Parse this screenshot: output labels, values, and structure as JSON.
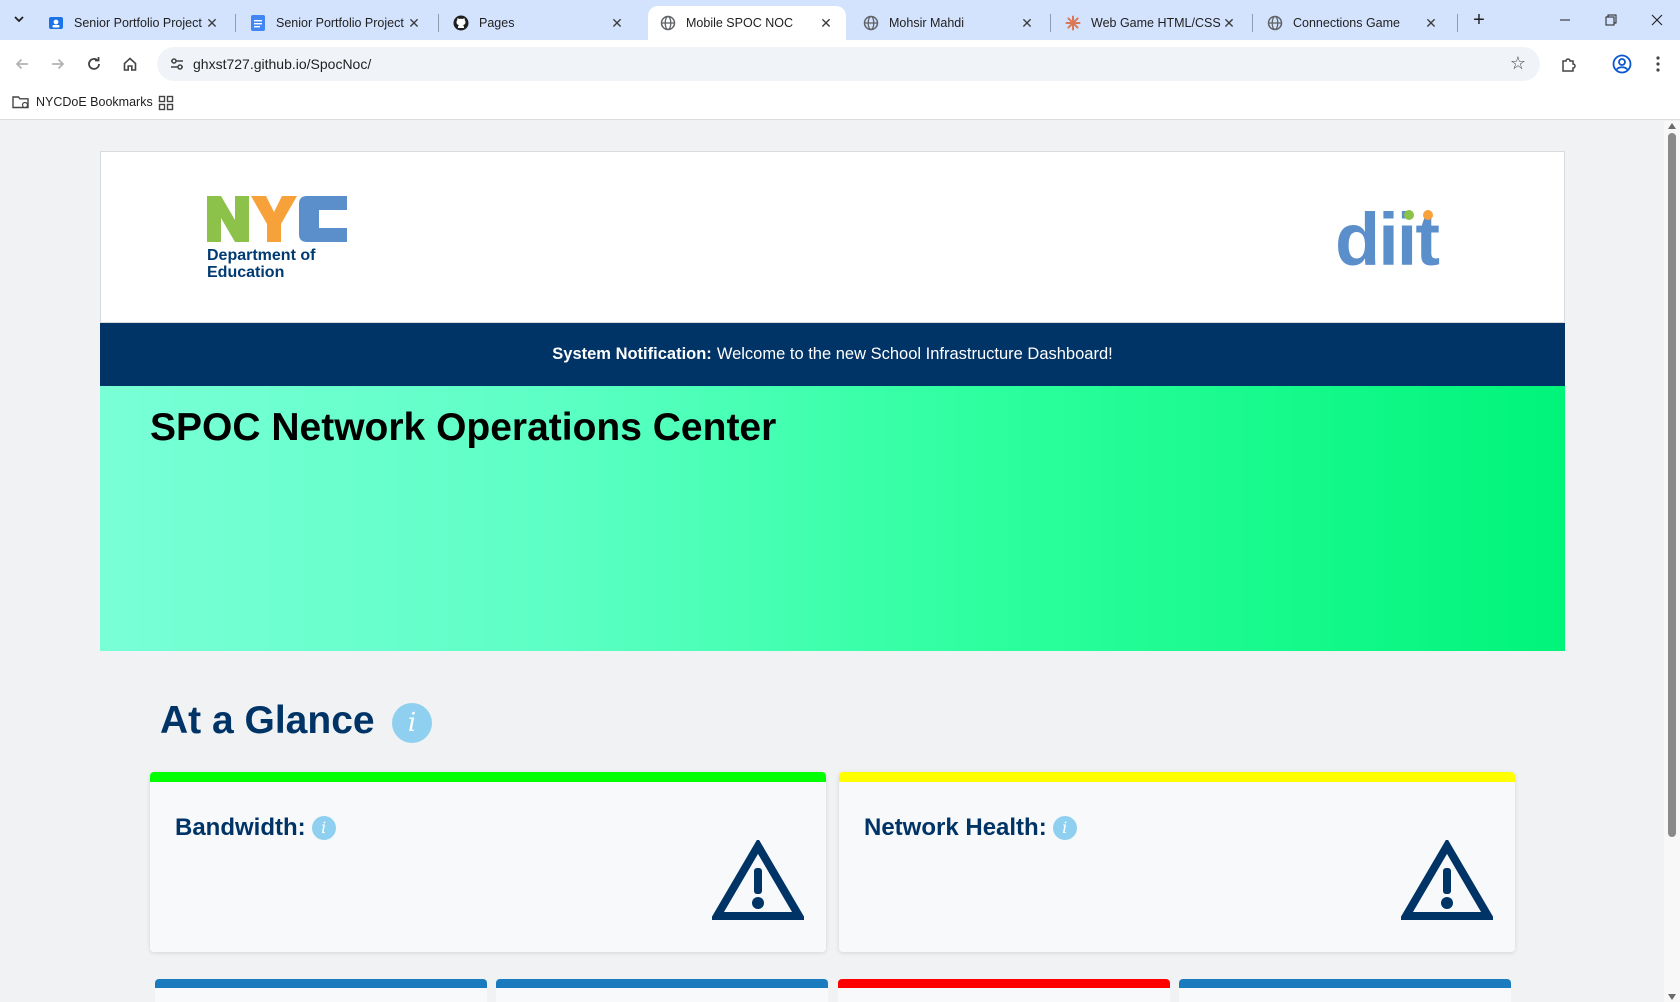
{
  "browser": {
    "tabs": [
      {
        "title": "Senior Portfolio Project",
        "favicon": "classroom-icon",
        "active": false
      },
      {
        "title": "Senior Portfolio Project - ",
        "favicon": "docs-icon",
        "active": false
      },
      {
        "title": "Pages",
        "favicon": "github-icon",
        "active": false
      },
      {
        "title": "Mobile SPOC NOC",
        "favicon": "globe-icon",
        "active": true
      },
      {
        "title": "Mohsir Mahdi",
        "favicon": "globe-icon",
        "active": false
      },
      {
        "title": "Web Game HTML/CSS Re",
        "favicon": "claude-icon",
        "active": false
      },
      {
        "title": "Connections Game",
        "favicon": "globe-icon",
        "active": false
      }
    ],
    "url": "ghxst727.github.io/SpocNoc/",
    "bookmarks": {
      "folder_label": "NYCDoE Bookmarks"
    }
  },
  "page": {
    "header": {
      "nyc_logo_text": "NYC",
      "department_line1": "Department of",
      "department_line2": "Education",
      "diit_logo_text": "diit"
    },
    "notification": {
      "label": "System Notification:",
      "message": "Welcome to the new School Infrastructure Dashboard!"
    },
    "hero_title": "SPOC Network Operations Center",
    "glance": {
      "title": "At a Glance",
      "info_glyph": "i",
      "cards": [
        {
          "label": "Bandwidth:",
          "status_color": "#00ff00",
          "status_icon": "warning-icon"
        },
        {
          "label": "Network Health:",
          "status_color": "#ffff00",
          "status_icon": "warning-icon"
        }
      ],
      "mini_cards": [
        {
          "status_color": "#1a7bbf"
        },
        {
          "status_color": "#1a7bbf"
        },
        {
          "status_color": "#ff0000"
        },
        {
          "status_color": "#1a7bbf"
        }
      ]
    }
  },
  "colors": {
    "brand_navy": "#003366",
    "nyc_green": "#8cc14a",
    "nyc_orange": "#f7a13b",
    "nyc_blue": "#5b8fcc",
    "diit_blue": "#5b8fcc",
    "hero_gradient_start": "#79ffd6",
    "hero_gradient_end": "#00f47a"
  }
}
